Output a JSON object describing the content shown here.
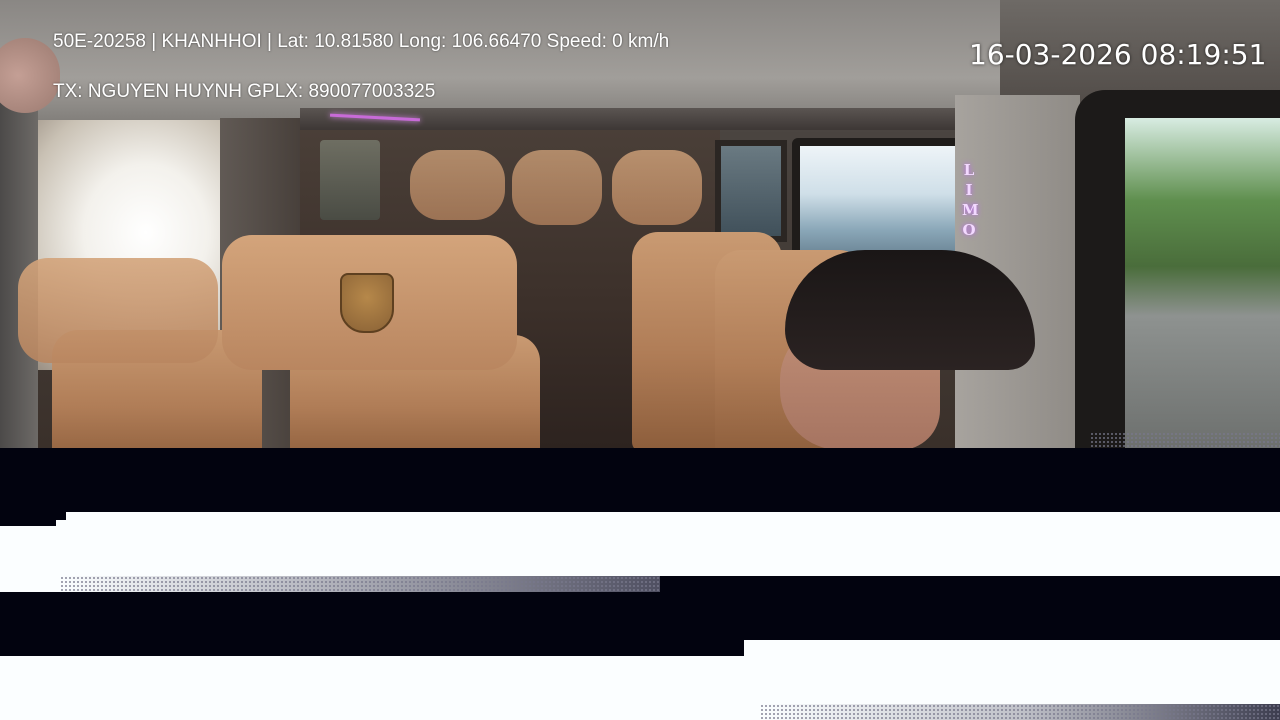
{
  "overlay": {
    "vehicle_info": "50E-20258 | KHANHHOI | Lat: 10.81580 Long: 106.66470 Speed: 0 km/h",
    "driver_info": "TX: NGUYEN HUYNH GPLX: 890077003325",
    "timestamp": "16-03-2026 08:19:51"
  },
  "scene": {
    "side_label": "LIMO"
  },
  "colors": {
    "overlay_text": "#ffffff",
    "corrupt_dark": "#02030f",
    "corrupt_light": "#fbfeff",
    "seat_leather": "#b98660",
    "limo_glow": "#c060ff"
  }
}
